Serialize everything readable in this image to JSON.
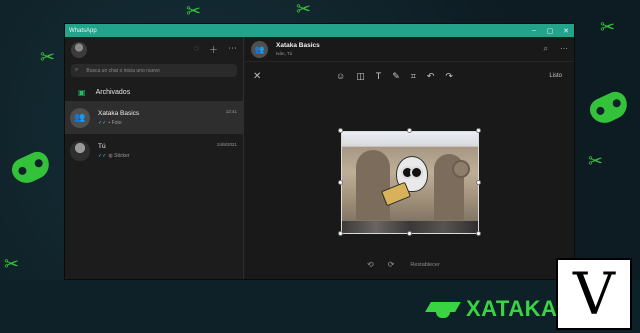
{
  "window": {
    "title": "WhatsApp",
    "controls": [
      "–",
      "▢",
      "✕"
    ]
  },
  "sidebar": {
    "header_icons": [
      "status-icon",
      "new-chat-icon",
      "menu-icon"
    ],
    "search_placeholder": "Busca un chat o inicia uno nuevo",
    "archived_label": "Archivados",
    "chats": [
      {
        "name": "Xataka Basics",
        "time": "12:41",
        "preview": "Foto",
        "active": true
      },
      {
        "name": "Tú",
        "time": "24/8/2021",
        "preview": "Sticker",
        "active": false
      }
    ]
  },
  "chat_header": {
    "name": "Xataka Basics",
    "subtitle": "Iván, Tú"
  },
  "editor": {
    "tools": [
      "emoji-icon",
      "sticker-icon",
      "text-icon",
      "pencil-icon",
      "crop-icon",
      "undo-icon",
      "redo-icon"
    ],
    "done_label": "Listo",
    "reset_label": "Restablecer"
  },
  "banner": {
    "brand_text": "XATAKA B"
  },
  "watermark": {
    "text": "V"
  },
  "colors": {
    "titlebar": "#23a38c",
    "accent": "#21c063",
    "brand": "#39d442"
  }
}
